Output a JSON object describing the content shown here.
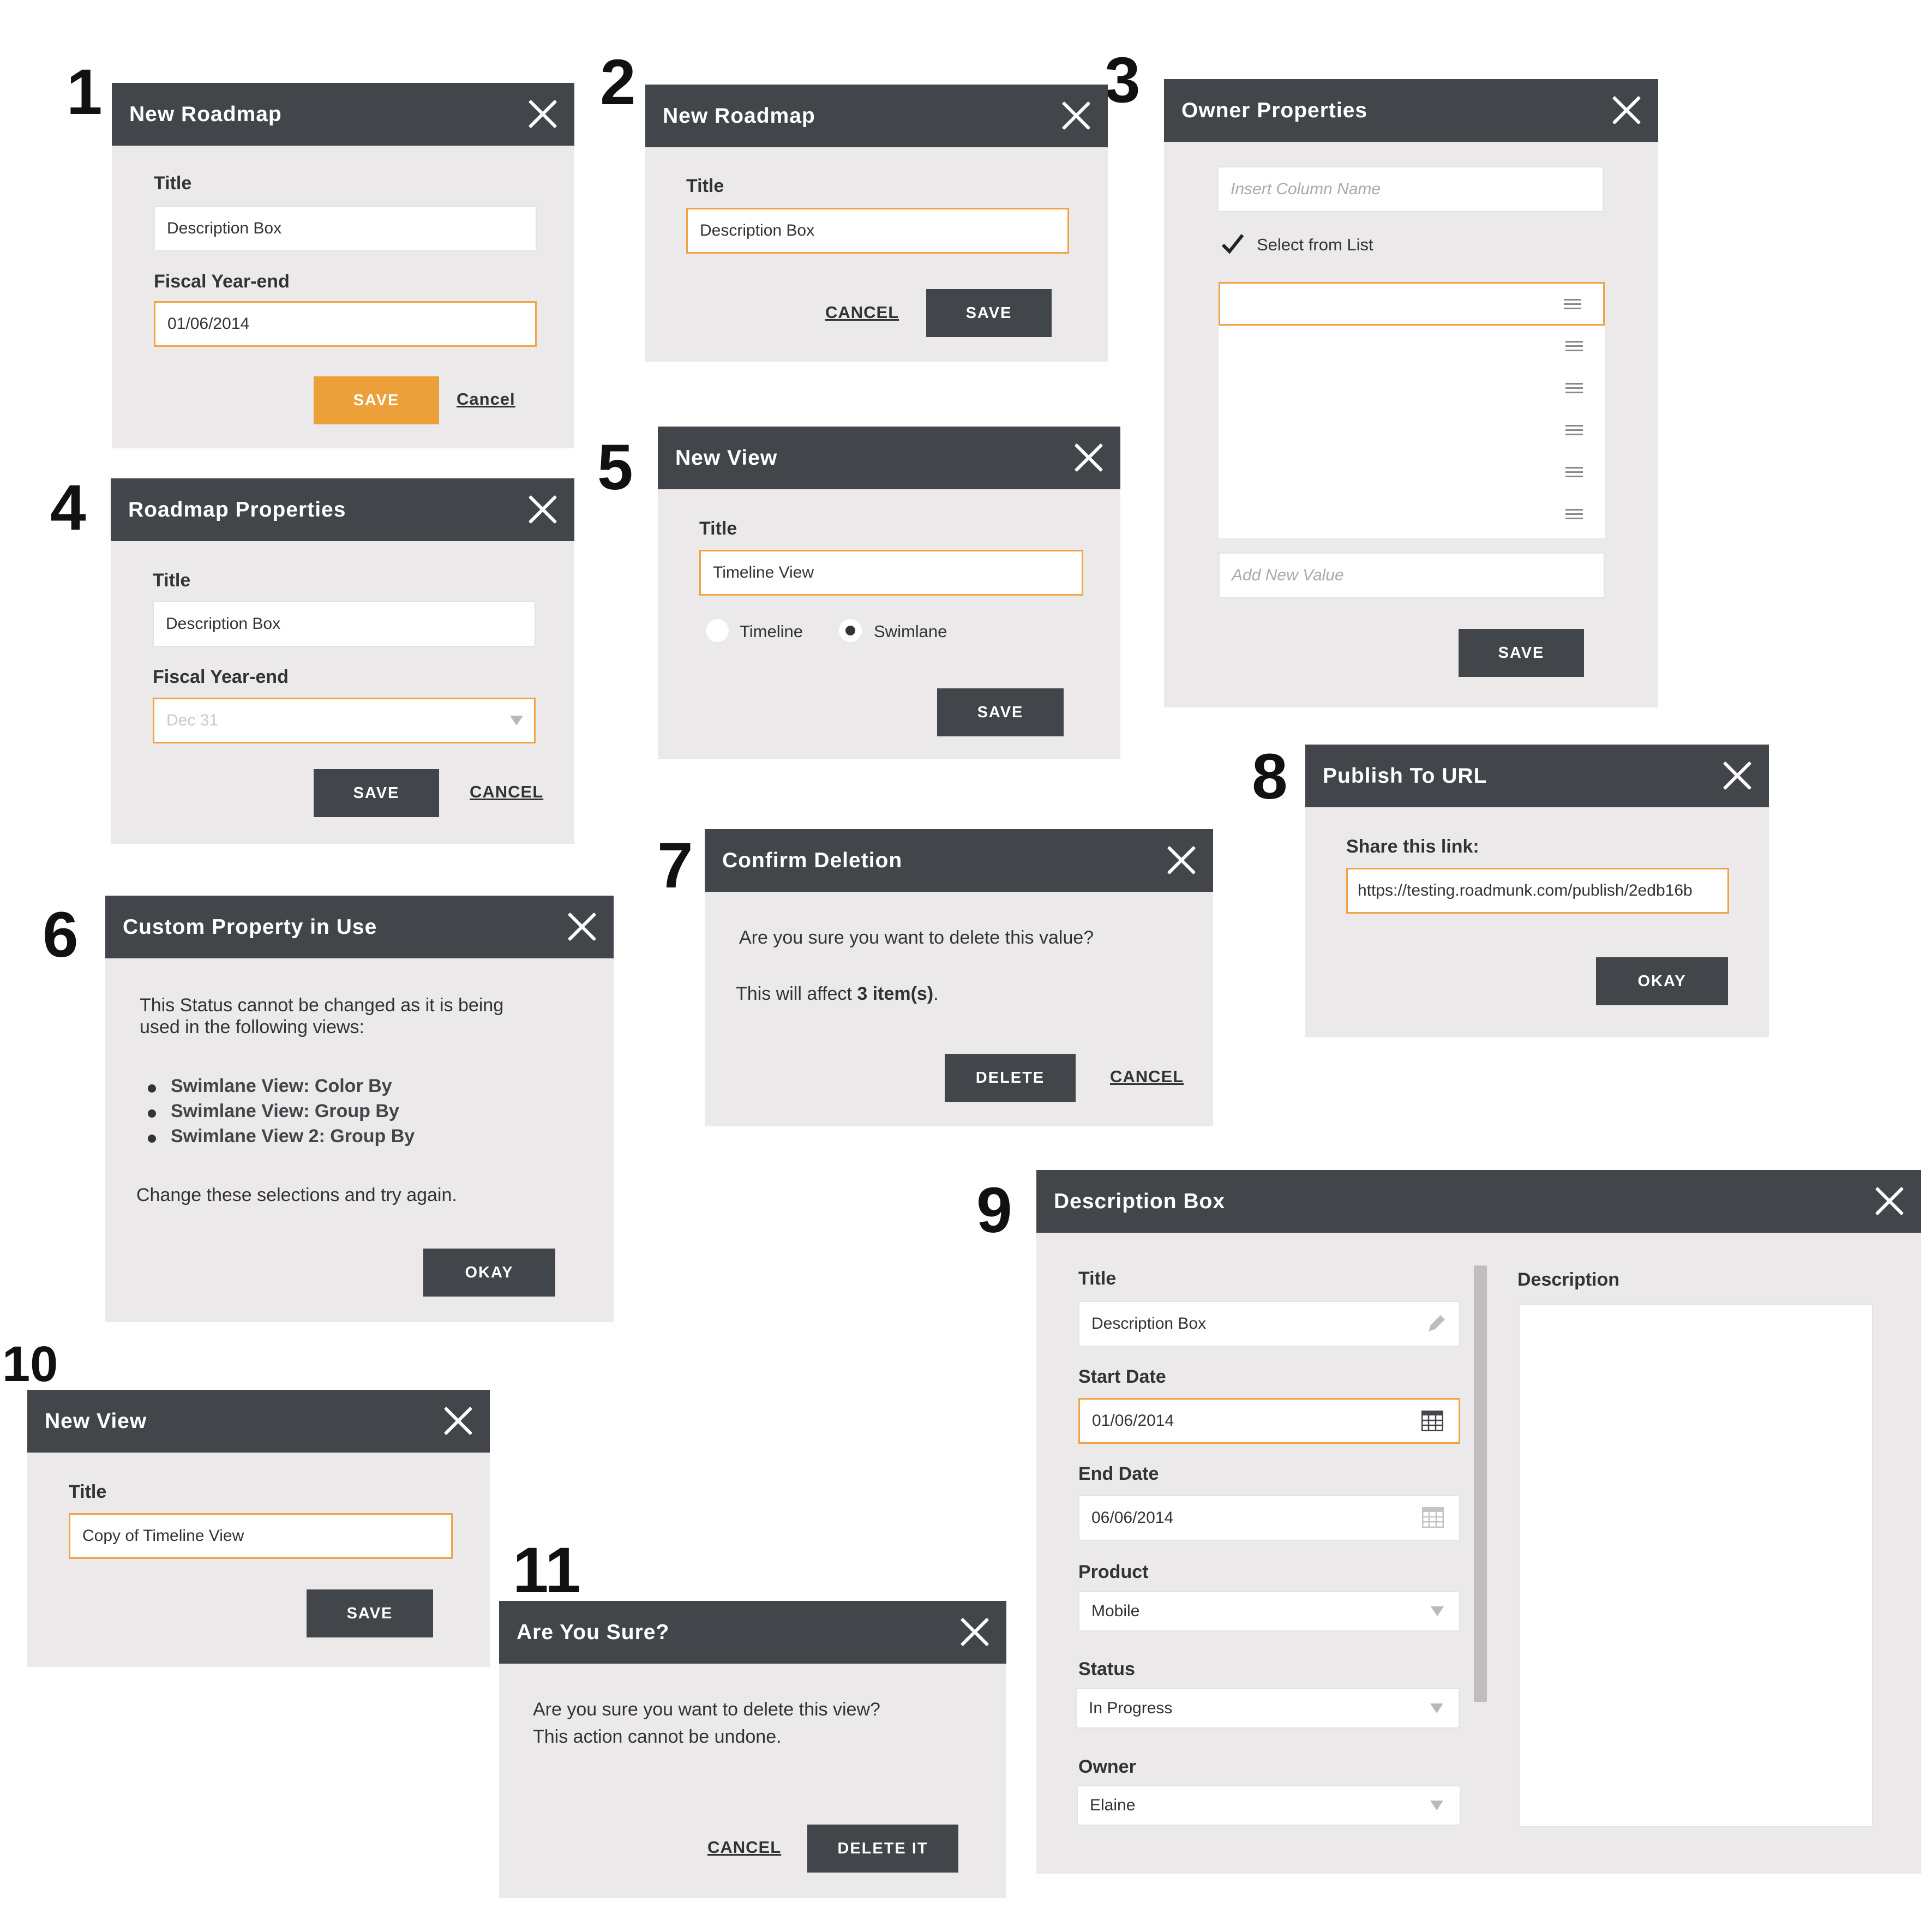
{
  "numbers": [
    "1",
    "2",
    "3",
    "4",
    "5",
    "6",
    "7",
    "8",
    "9",
    "10",
    "11"
  ],
  "d1": {
    "title": "New Roadmap",
    "title_label": "Title",
    "title_value": "Description Box",
    "fiscal_label": "Fiscal Year-end",
    "fiscal_value": "01/06/2014",
    "save": "SAVE",
    "cancel": "Cancel"
  },
  "d2": {
    "title": "New Roadmap",
    "title_label": "Title",
    "title_value": "Description Box",
    "cancel": "CANCEL",
    "save": "SAVE"
  },
  "d3": {
    "title": "Owner Properties",
    "column_placeholder": "Insert Column Name",
    "select_label": "Select from List",
    "add_placeholder": "Add New Value",
    "save": "SAVE"
  },
  "d4": {
    "title": "Roadmap Properties",
    "title_label": "Title",
    "title_value": "Description Box",
    "fiscal_label": "Fiscal Year-end",
    "fiscal_value": "Dec 31",
    "save": "SAVE",
    "cancel": "CANCEL"
  },
  "d5": {
    "title": "New View",
    "title_label": "Title",
    "title_value": "Timeline View",
    "opt1": "Timeline",
    "opt2": "Swimlane",
    "selected": "Swimlane",
    "save": "SAVE"
  },
  "d6": {
    "title": "Custom Property in Use",
    "line1": "This Status cannot be changed as it is being",
    "line2": "used in the following views:",
    "items": [
      "Swimlane View: Color By",
      "Swimlane View: Group By",
      "Swimlane View 2: Group By"
    ],
    "footer": "Change these selections and try again.",
    "okay": "OKAY"
  },
  "d7": {
    "title": "Confirm Deletion",
    "question": "Are you sure you want to delete this value?",
    "affect_prefix": "This will affect ",
    "affect_count": "3 item(s)",
    "affect_suffix": ".",
    "delete": "DELETE",
    "cancel": "CANCEL"
  },
  "d8": {
    "title": "Publish To URL",
    "share_label": "Share this link:",
    "url": "https://testing.roadmunk.com/publish/2edb16b",
    "okay": "OKAY"
  },
  "d9": {
    "title": "Description Box",
    "title_label": "Title",
    "title_value": "Description Box",
    "start_label": "Start Date",
    "start_value": "01/06/2014",
    "end_label": "End Date",
    "end_value": "06/06/2014",
    "product_label": "Product",
    "product_value": "Mobile",
    "status_label": "Status",
    "status_value": "In Progress",
    "owner_label": "Owner",
    "owner_value": "Elaine",
    "description_label": "Description"
  },
  "d10": {
    "title": "New View",
    "title_label": "Title",
    "title_value": "Copy of Timeline View",
    "save": "SAVE"
  },
  "d11": {
    "title": "Are You Sure?",
    "line1": "Are you sure you want to delete this view?",
    "line2": "This action cannot be undone.",
    "cancel": "CANCEL",
    "delete": "DELETE IT"
  }
}
